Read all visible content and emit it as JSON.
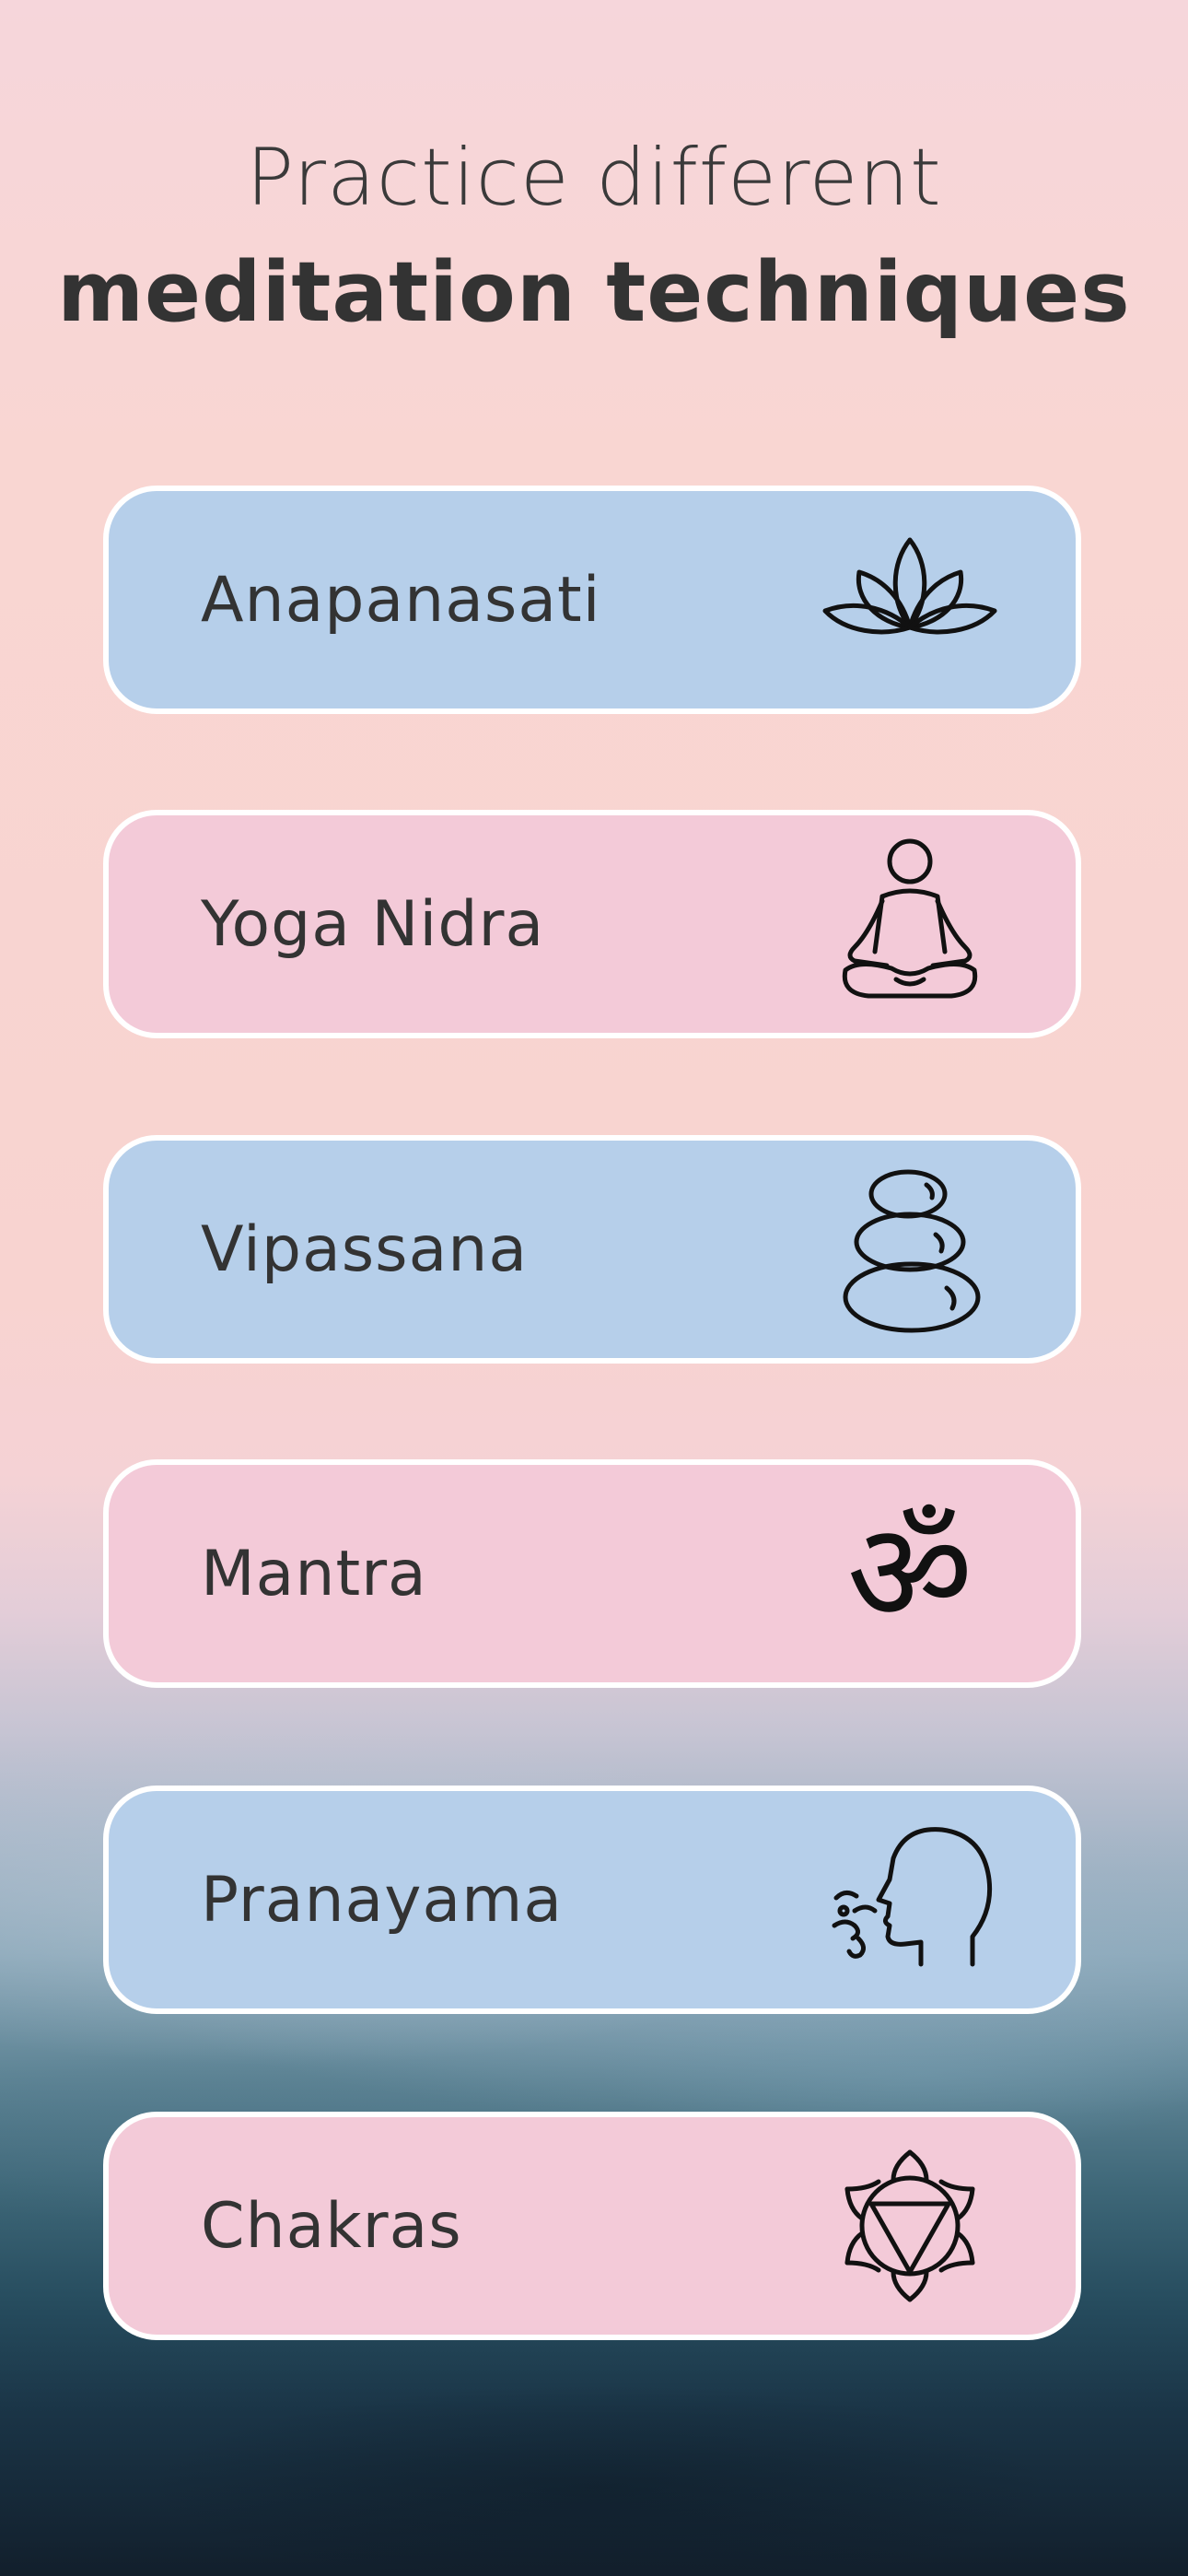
{
  "header": {
    "title_line1": "Practice different",
    "title_line2": "meditation techniques"
  },
  "techniques": [
    {
      "label": "Anapanasati",
      "icon": "lotus-icon",
      "color": "#b6cfea"
    },
    {
      "label": "Yoga Nidra",
      "icon": "meditating-person-icon",
      "color": "#f3cad8"
    },
    {
      "label": "Vipassana",
      "icon": "stacked-stones-icon",
      "color": "#b6cfea"
    },
    {
      "label": "Mantra",
      "icon": "om-symbol-icon",
      "color": "#f3cad8"
    },
    {
      "label": "Pranayama",
      "icon": "breathing-head-icon",
      "color": "#b6cfea"
    },
    {
      "label": "Chakras",
      "icon": "chakra-icon",
      "color": "#f3cad8"
    }
  ],
  "om_glyph": "ॐ"
}
